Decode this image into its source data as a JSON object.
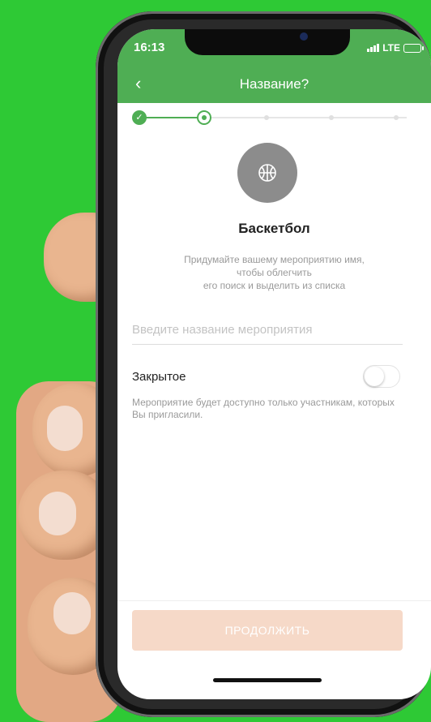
{
  "status_bar": {
    "time": "16:13",
    "network": "LTE"
  },
  "header": {
    "back_glyph": "‹",
    "title": "Название?"
  },
  "stepper": {
    "current_step": 2,
    "total_steps": 6
  },
  "sport": {
    "icon": "basketball-icon",
    "name": "Баскетбол"
  },
  "hint_text": "Придумайте вашему мероприятию имя,\nчтобы облегчить\nего поиск и выделить из списка",
  "event_name": {
    "value": "",
    "placeholder": "Введите название мероприятия"
  },
  "closed_option": {
    "label": "Закрытое",
    "enabled": false,
    "note": "Мероприятие будет доступно только участникам, которых Вы пригласили."
  },
  "continue_button": {
    "label": "ПРОДОЛЖИТЬ"
  },
  "colors": {
    "background": "#2ec935",
    "accent": "#4fae54",
    "button_disabled": "#f6d9c8",
    "icon_circle": "#8c8c8c"
  }
}
